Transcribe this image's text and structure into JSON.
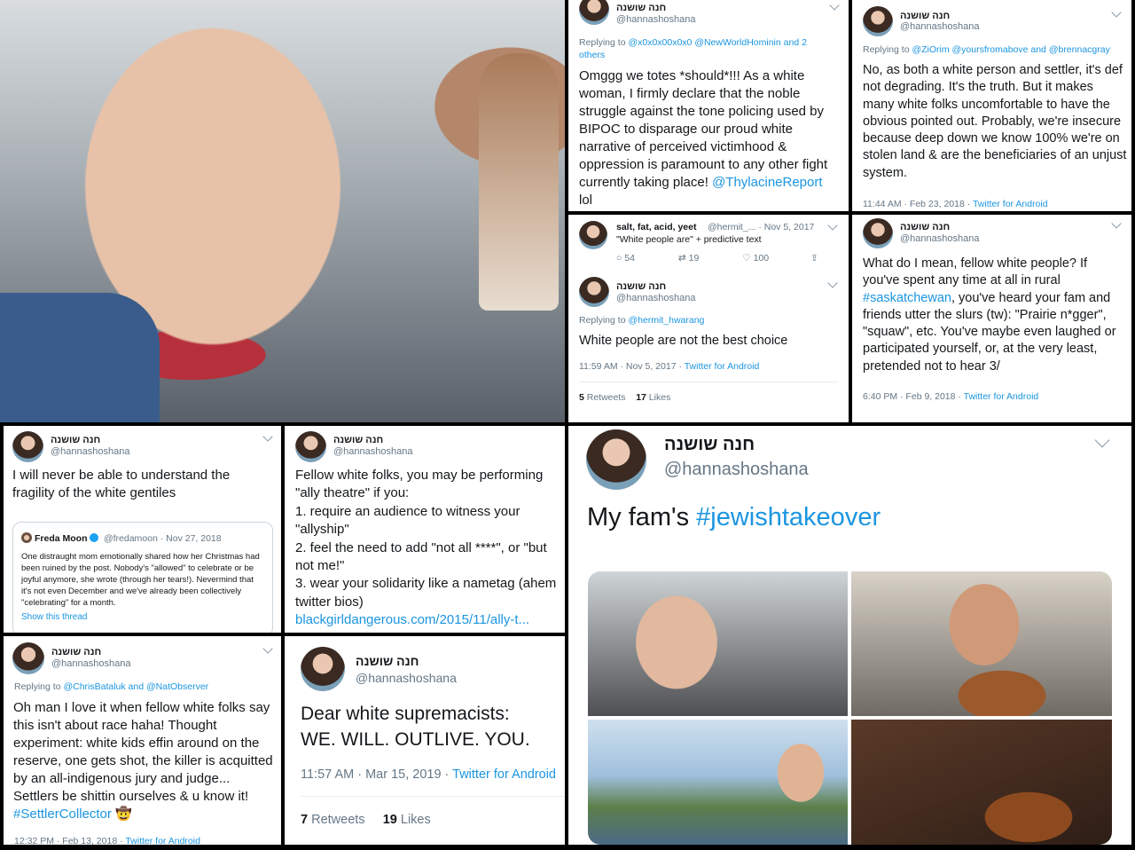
{
  "colors": {
    "link": "#1b95e0",
    "muted": "#657786",
    "text": "#14171a"
  },
  "author": {
    "name": "חנה שושנה",
    "handle": "@hannashoshana"
  },
  "t1": {
    "reply_prefix": "Replying to ",
    "reply_mentions": "@x0x0x00x0x0 @NewWorldHominin and 2 others",
    "text": "Omggg we totes *should*!!! As a white woman, I firmly declare that the noble struggle against the tone policing used by BIPOC to disparage our proud white narrative of perceived victimhood & oppression is paramount to any other fight currently taking place! ",
    "link": "@ThylacineReport",
    "tail": "lol"
  },
  "t2": {
    "reply_prefix": "Replying to ",
    "reply_mentions": "@ZiOrim @yoursfromabove and @brennacgray",
    "text": "No, as both a white person and settler, it's def not degrading. It's the truth. But it makes many white folks uncomfortable to have the obvious pointed out. Probably, we're insecure because deep down we know 100% we're on stolen land & are the beneficiaries of an unjust system.",
    "time": "11:44 AM · Feb 23, 2018 · ",
    "source": "Twitter for Android"
  },
  "t3": {
    "orig_name": "salt, fat, acid, yeet",
    "orig_handle": "@hermit_... · Nov 5, 2017",
    "orig_text": "\"White people are\" + predictive text",
    "replies": "54",
    "retweets": "19",
    "likes": "100",
    "reply_prefix": "Replying to ",
    "reply_mentions": "@hermit_hwarang",
    "text": "White people are not the best choice",
    "time": "11:59 AM · Nov 5, 2017 · ",
    "source": "Twitter for Android",
    "rt_count": "5",
    "rt_label": " Retweets",
    "like_count": "17",
    "like_label": " Likes"
  },
  "t4": {
    "text": "What do I mean, fellow white people? If you've spent any time at all in rural ",
    "hashtag": "#saskatchewan",
    "tail": ", you've heard your fam and friends utter the slurs (tw): \"Prairie n*gger\", \"squaw\", etc. You've maybe even laughed or participated yourself, or, at the very least, pretended not to hear 3/",
    "time": "6:40 PM · Feb 9, 2018 · ",
    "source": "Twitter for Android"
  },
  "t5": {
    "text": "I will never be able to understand the fragility of the white gentiles",
    "quote_name": "Freda Moon",
    "quote_handle": "@fredamoon · Nov 27, 2018",
    "quote_text": "One distraught mom emotionally shared how her Christmas had been ruined by the post. Nobody's \"allowed\" to celebrate or be joyful anymore, she wrote (through her tears!). Nevermind that it's not even December and we've already been collectively \"celebrating\" for a month.",
    "quote_show": "Show this thread"
  },
  "t6": {
    "text": "Fellow white folks, you may be performing \"ally theatre\" if you:\n1. require an audience to witness your \"allyship\"\n2. feel the need to add \"not all ****\", or \"but not me!\"\n3. wear your solidarity like a nametag (ahem twitter bios)",
    "link": "blackgirldangerous.com/2015/11/ally-t..."
  },
  "t7": {
    "text": "My fam's ",
    "hashtag": "#jewishtakeover"
  },
  "t8": {
    "reply_prefix": "Replying to ",
    "reply_mentions": "@ChrisBataluk and @NatObserver",
    "text": "Oh man I love it when fellow white folks say this isn't about race haha! Thought experiment: white kids effin around on the reserve, one gets shot, the killer is acquitted by an all-indigenous jury and judge... Settlers be shittin ourselves & u know it! ",
    "hashtag": "#SettlerCollector",
    "emoji": "🤠",
    "time": "12:32 PM · Feb 13, 2018 · ",
    "source": "Twitter for Android"
  },
  "t9": {
    "text": "Dear white supremacists:\nWE. WILL. OUTLIVE. YOU.",
    "time": "11:57 AM · Mar 15, 2019 · ",
    "source": "Twitter for Android",
    "rt_count": "7",
    "rt_label": " Retweets",
    "like_count": "19",
    "like_label": " Likes"
  }
}
